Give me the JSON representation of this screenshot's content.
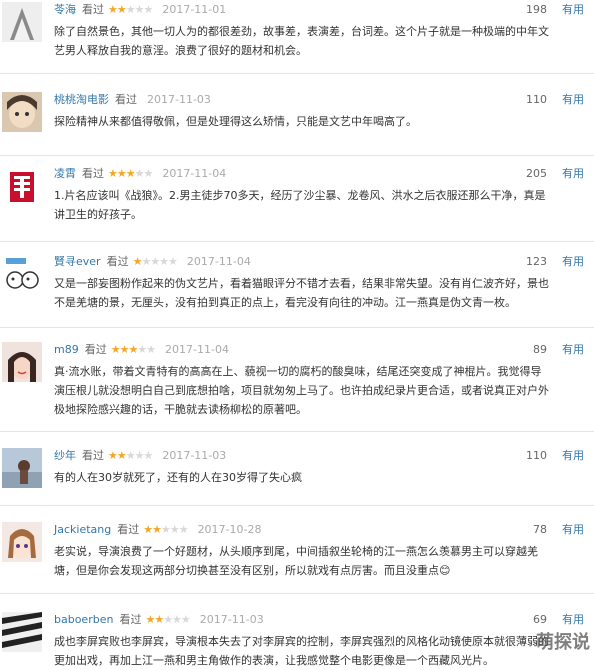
{
  "reviews": [
    {
      "user": "苓海",
      "action": "看过",
      "rating": 2,
      "date": "2017-11-01",
      "votes": "198",
      "useful": "有用",
      "content": "除了自然景色，其他一切人为的都很差劲，故事差，表演差，台词差。这个片子就是一种极端的中年文艺男人释放自我的意淫。浪费了很好的题材和机会。",
      "avatar": "silhouette-avatar"
    },
    {
      "user": "桃桃淘电影",
      "action": "看过",
      "rating": 0,
      "date": "2017-11-03",
      "votes": "110",
      "useful": "有用",
      "content": "探险精神从来都值得敬佩，但是处理得这么矫情，只能是文艺中年喝高了。",
      "avatar": "anime-avatar"
    },
    {
      "user": "凌霄",
      "action": "看过",
      "rating": 3,
      "date": "2017-11-04",
      "votes": "205",
      "useful": "有用",
      "content": "1.片名应该叫《战狼》。2.男主徒步70多天，经历了沙尘暴、龙卷风、洪水之后衣服还那么干净，真是讲卫生的好孩子。",
      "avatar": "double-happiness-avatar"
    },
    {
      "user": "賢寻ever",
      "action": "看过",
      "rating": 1,
      "date": "2017-11-04",
      "votes": "123",
      "useful": "有用",
      "content": "又是一部妄图粉作起来的伪文艺片，看着猫眼评分不错才去看，结果非常失望。没有肖仁波齐好，景也不是羌塘的景，无厘头，没有拍到真正的点上，看完没有向往的冲动。江一燕真是伪文青一枚。",
      "avatar": "cartoon-avatar"
    },
    {
      "user": "m89",
      "action": "看过",
      "rating": 3,
      "date": "2017-11-04",
      "votes": "89",
      "useful": "有用",
      "content": "真·流水账，带着文青特有的高高在上、藐视一切的腐朽的酸臭味，结尾还突变成了神棍片。我觉得导演压根儿就没想明白自己到底想拍啥，项目就匆匆上马了。也许拍成纪录片更合适，或者说真正对户外极地探险感兴趣的话，干脆就去读杨柳松的原著吧。",
      "avatar": "girl-avatar"
    },
    {
      "user": "纱年",
      "action": "看过",
      "rating": 2,
      "date": "2017-11-03",
      "votes": "110",
      "useful": "有用",
      "content": "有的人在30岁就死了，还有的人在30岁得了失心疯",
      "avatar": "landscape-avatar"
    },
    {
      "user": "Jackietang",
      "action": "看过",
      "rating": 2,
      "date": "2017-10-28",
      "votes": "78",
      "useful": "有用",
      "content": "老实说，导演浪费了一个好题材，从头顺序到尾，中间插叙坐轮椅的江一燕怎么羡慕男主可以穿越羌塘，但是你会发现这两部分切换甚至没有区别，所以就戏有点厉害。而且没重点😊",
      "avatar": "anime-girl-avatar"
    },
    {
      "user": "baboerben",
      "action": "看过",
      "rating": 2,
      "date": "2017-11-03",
      "votes": "69",
      "useful": "有用",
      "content": "成也李屏宾败也李屏宾，导演根本失去了对李屏宾的控制，李屏宾强烈的风格化动镜使原本就很薄弱的更加出戏，再加上江一燕和男主角做作的表演，让我感觉整个电影更像是一个西藏风光片。",
      "avatar": "zebra-avatar"
    }
  ],
  "watermark": "萌探说"
}
